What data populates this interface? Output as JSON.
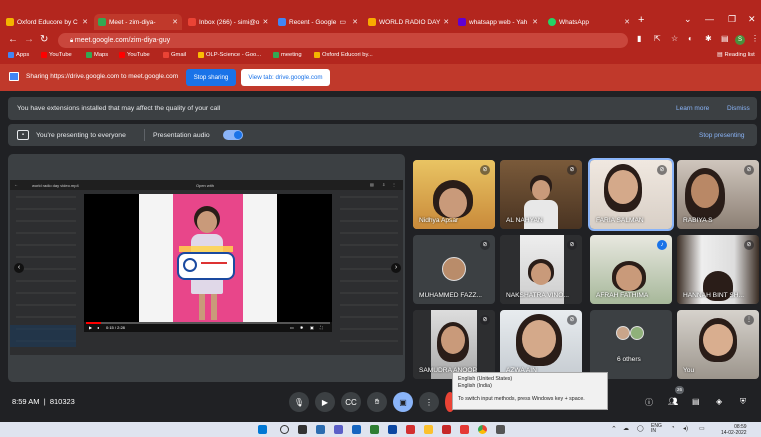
{
  "browser": {
    "tabs": [
      {
        "label": "Oxford Educore by C",
        "favicon_color": "#f4b400"
      },
      {
        "label": "Meet - zim-diya-",
        "favicon_color": "#34a853",
        "active": true
      },
      {
        "label": "Inbox (266) - simi@o",
        "favicon_color": "#ea4335"
      },
      {
        "label": "Recent - Google",
        "favicon_color": "#4285f4"
      },
      {
        "label": "WORLD RADIO DAY",
        "favicon_color": "#f9ab00"
      },
      {
        "label": "whatsapp web - Yah",
        "favicon_color": "#6001d2"
      },
      {
        "label": "WhatsApp",
        "favicon_color": "#25d366"
      }
    ],
    "new_tab": "+",
    "url": "meet.google.com/zim-diya-guy",
    "profile_initial": "S",
    "bookmarks": [
      {
        "label": "Apps",
        "color": "#4285f4"
      },
      {
        "label": "YouTube",
        "color": "#ff0000"
      },
      {
        "label": "Maps",
        "color": "#34a853"
      },
      {
        "label": "YouTube",
        "color": "#ff0000"
      },
      {
        "label": "Gmail",
        "color": "#ea4335"
      },
      {
        "label": "OLP-Science - Goo...",
        "color": "#fbbc04"
      },
      {
        "label": "meeting",
        "color": "#34a853"
      },
      {
        "label": "Oxford Educori by...",
        "color": "#f4b400"
      }
    ],
    "reading_list": "Reading list"
  },
  "share_bar": {
    "text": "Sharing https://drive.google.com to meet.google.com",
    "stop_label": "Stop sharing",
    "view_label": "View tab: drive.google.com"
  },
  "extension_banner": {
    "message": "You have extensions installed that may affect the quality of your call",
    "learn_more": "Learn more",
    "dismiss": "Dismiss"
  },
  "presenting_banner": {
    "text": "You're presenting to everyone",
    "audio": "Presentation audio",
    "stop": "Stop presenting"
  },
  "presentation": {
    "window_title": "world radio day video.mp4",
    "open_with": "Open with",
    "time": "0:15 / 2:28",
    "progress": 0.06
  },
  "participants": [
    {
      "name": "Nidhya Apsar",
      "muted": true
    },
    {
      "name": "AL NAHYAN",
      "muted": true
    },
    {
      "name": "FARIA SALMAN",
      "muted": true,
      "selected": true
    },
    {
      "name": "RABIYA S",
      "muted": true
    },
    {
      "name": "MUHAMMED FAZZ...",
      "muted": true,
      "avatar": true
    },
    {
      "name": "NAKSHATRA VINO...",
      "muted": true
    },
    {
      "name": "AFRAH FATHIMA",
      "muted": false,
      "speaking": true
    },
    {
      "name": "HANNAH BINT SH...",
      "muted": true
    },
    {
      "name": "SAMUDRA ANOOP",
      "muted": true
    },
    {
      "name": "AZWA AIN",
      "muted": true
    },
    {
      "name": "6 others",
      "muted": false,
      "group": true
    },
    {
      "name": "You",
      "muted": false
    }
  ],
  "bottom_bar": {
    "time": "8:59 AM",
    "separator": "|",
    "meeting_code": "810323",
    "participant_count": "26"
  },
  "ime_tooltip": {
    "line1": "English (United States)",
    "line2": "English (India)",
    "tip": "To switch input methods, press Windows key + space."
  },
  "taskbar": {
    "lang": "ENG",
    "region": "IN",
    "time": "08:59",
    "date": "14-02-2022"
  }
}
